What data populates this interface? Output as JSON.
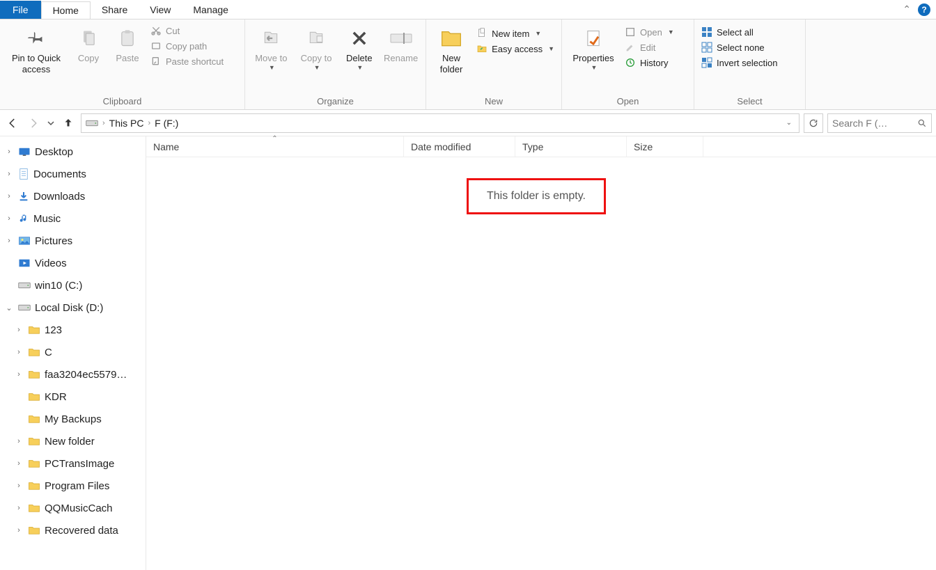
{
  "tabs": {
    "file": "File",
    "home": "Home",
    "share": "Share",
    "view": "View",
    "manage": "Manage"
  },
  "ribbon": {
    "clipboard": {
      "label": "Clipboard",
      "pin": "Pin to Quick access",
      "copy": "Copy",
      "paste": "Paste",
      "cut": "Cut",
      "copy_path": "Copy path",
      "paste_shortcut": "Paste shortcut"
    },
    "organize": {
      "label": "Organize",
      "move_to": "Move to",
      "copy_to": "Copy to",
      "delete": "Delete",
      "rename": "Rename"
    },
    "new": {
      "label": "New",
      "new_folder": "New folder",
      "new_item": "New item",
      "easy_access": "Easy access"
    },
    "open": {
      "label": "Open",
      "properties": "Properties",
      "open": "Open",
      "edit": "Edit",
      "history": "History"
    },
    "select": {
      "label": "Select",
      "select_all": "Select all",
      "select_none": "Select none",
      "invert": "Invert selection"
    }
  },
  "breadcrumb": {
    "root": "This PC",
    "current": "F (F:)"
  },
  "search": {
    "placeholder": "Search F (…"
  },
  "columns": {
    "name": "Name",
    "date": "Date modified",
    "type": "Type",
    "size": "Size"
  },
  "empty_message": "This folder is empty.",
  "tree": [
    {
      "label": "Desktop",
      "icon": "desktop",
      "expand": "›",
      "indent": 0
    },
    {
      "label": "Documents",
      "icon": "documents",
      "expand": "›",
      "indent": 0
    },
    {
      "label": "Downloads",
      "icon": "downloads",
      "expand": "›",
      "indent": 0
    },
    {
      "label": "Music",
      "icon": "music",
      "expand": "›",
      "indent": 0
    },
    {
      "label": "Pictures",
      "icon": "pictures",
      "expand": "›",
      "indent": 0
    },
    {
      "label": "Videos",
      "icon": "videos",
      "expand": "",
      "indent": 0
    },
    {
      "label": "win10 (C:)",
      "icon": "drive",
      "expand": "",
      "indent": 0
    },
    {
      "label": "Local Disk (D:)",
      "icon": "drive",
      "expand": "⌄",
      "indent": 0
    },
    {
      "label": "123",
      "icon": "folder",
      "expand": "›",
      "indent": 1
    },
    {
      "label": "C",
      "icon": "folder",
      "expand": "›",
      "indent": 1
    },
    {
      "label": "faa3204ec5579…",
      "icon": "folder",
      "expand": "›",
      "indent": 1
    },
    {
      "label": "KDR",
      "icon": "folder",
      "expand": "",
      "indent": 1
    },
    {
      "label": "My Backups",
      "icon": "folder",
      "expand": "",
      "indent": 1
    },
    {
      "label": "New folder",
      "icon": "folder",
      "expand": "›",
      "indent": 1
    },
    {
      "label": "PCTransImage",
      "icon": "folder",
      "expand": "›",
      "indent": 1
    },
    {
      "label": "Program Files",
      "icon": "folder",
      "expand": "›",
      "indent": 1
    },
    {
      "label": "QQMusicCach",
      "icon": "folder",
      "expand": "›",
      "indent": 1
    },
    {
      "label": "Recovered data",
      "icon": "folder",
      "expand": "›",
      "indent": 1
    }
  ]
}
